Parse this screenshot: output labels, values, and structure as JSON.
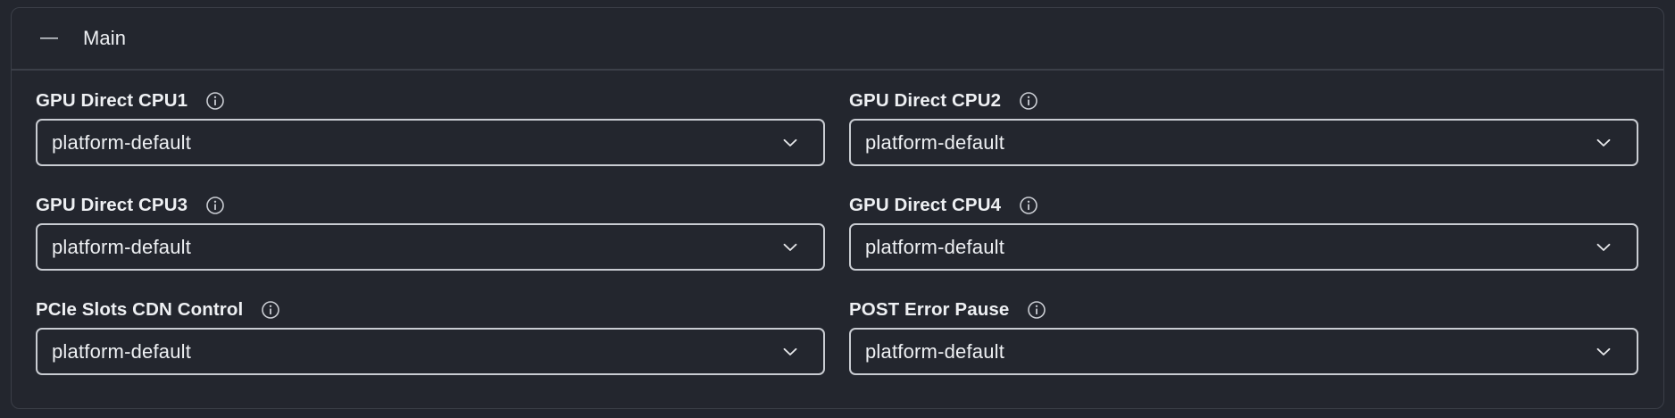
{
  "panel": {
    "title": "Main",
    "collapse_icon": "minus-icon"
  },
  "fields": [
    {
      "label": "GPU Direct CPU1",
      "value": "platform-default",
      "info_icon": "info-circle-icon",
      "select_icon": "chevron-down-icon"
    },
    {
      "label": "GPU Direct CPU2",
      "value": "platform-default",
      "info_icon": "info-circle-icon",
      "select_icon": "chevron-down-icon"
    },
    {
      "label": "GPU Direct CPU3",
      "value": "platform-default",
      "info_icon": "info-circle-icon",
      "select_icon": "chevron-down-icon"
    },
    {
      "label": "GPU Direct CPU4",
      "value": "platform-default",
      "info_icon": "info-circle-icon",
      "select_icon": "chevron-down-icon"
    },
    {
      "label": "PCIe Slots CDN Control",
      "value": "platform-default",
      "info_icon": "info-circle-icon",
      "select_icon": "chevron-down-icon"
    },
    {
      "label": "POST Error Pause",
      "value": "platform-default",
      "info_icon": "info-circle-icon",
      "select_icon": "chevron-down-icon"
    }
  ],
  "colors": {
    "background": "#23262e",
    "border": "#3b3f48",
    "select_border": "#c9ccd2",
    "text": "#eef0f3"
  }
}
